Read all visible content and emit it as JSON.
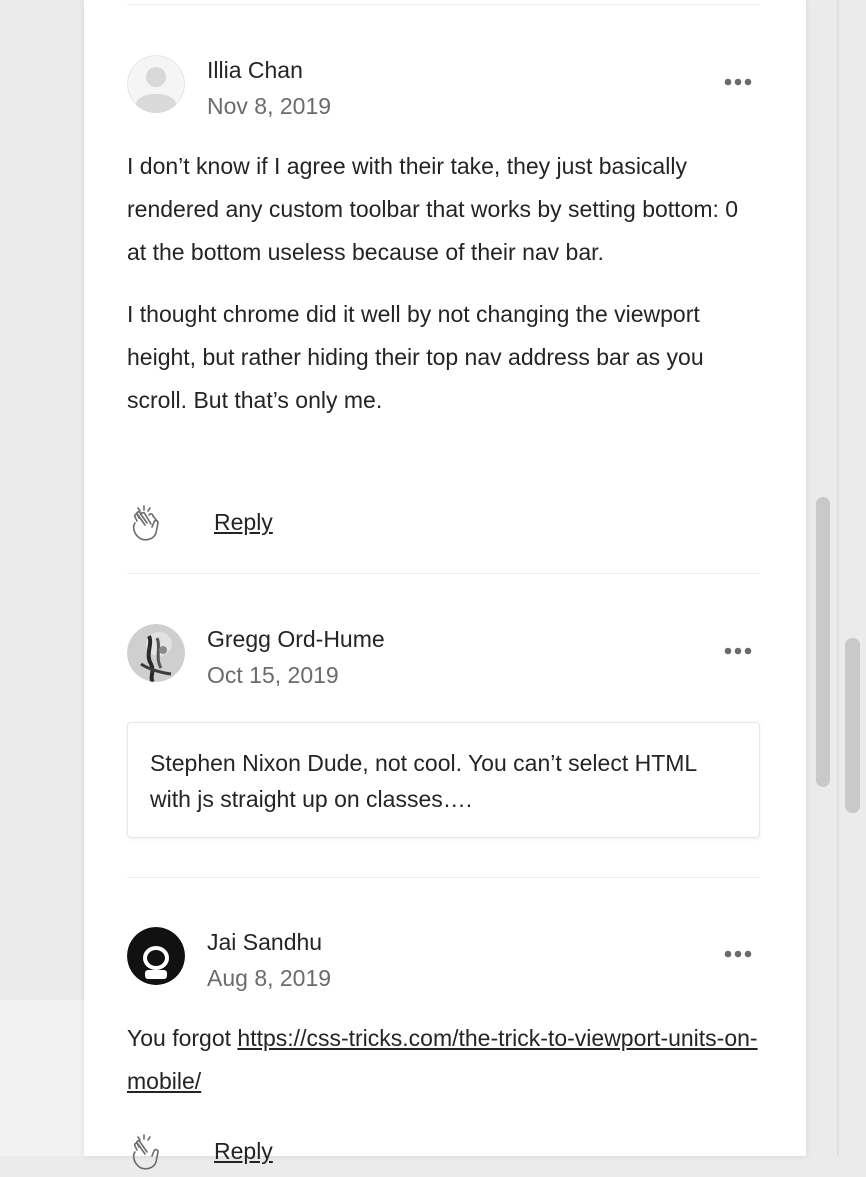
{
  "comments": [
    {
      "author": "Illia Chan",
      "date": "Nov 8, 2019",
      "avatar": "default-user-icon",
      "paragraphs": [
        "I don’t know if I agree with their take, they just basically rendered any custom toolbar that works by setting bottom: 0 at the bottom useless because of their nav bar.",
        "I thought chrome did it well by not changing the viewport height, but rather hiding their top nav address bar as you scroll. But that’s only me."
      ],
      "reply_label": "Reply"
    },
    {
      "author": "Gregg Ord-Hume",
      "date": "Oct 15, 2019",
      "avatar": "photo-avatar",
      "quote": "Stephen Nixon Dude, not cool. You can’t select HTML with js straight up on classes…."
    },
    {
      "author": "Jai Sandhu",
      "date": "Aug 8, 2019",
      "avatar": "astronaut-avatar",
      "text_prefix": "You forgot ",
      "link_text": "https://css-tricks.com/the-trick-to-viewport-units-on-mobile/",
      "reply_label": "Reply"
    }
  ],
  "icons": {
    "more": "more-horizontal-icon",
    "clap": "clap-icon"
  },
  "colors": {
    "text": "#242424",
    "muted": "#6b6b6b",
    "divider": "#eeeeee",
    "page_bg": "#ebebeb"
  }
}
